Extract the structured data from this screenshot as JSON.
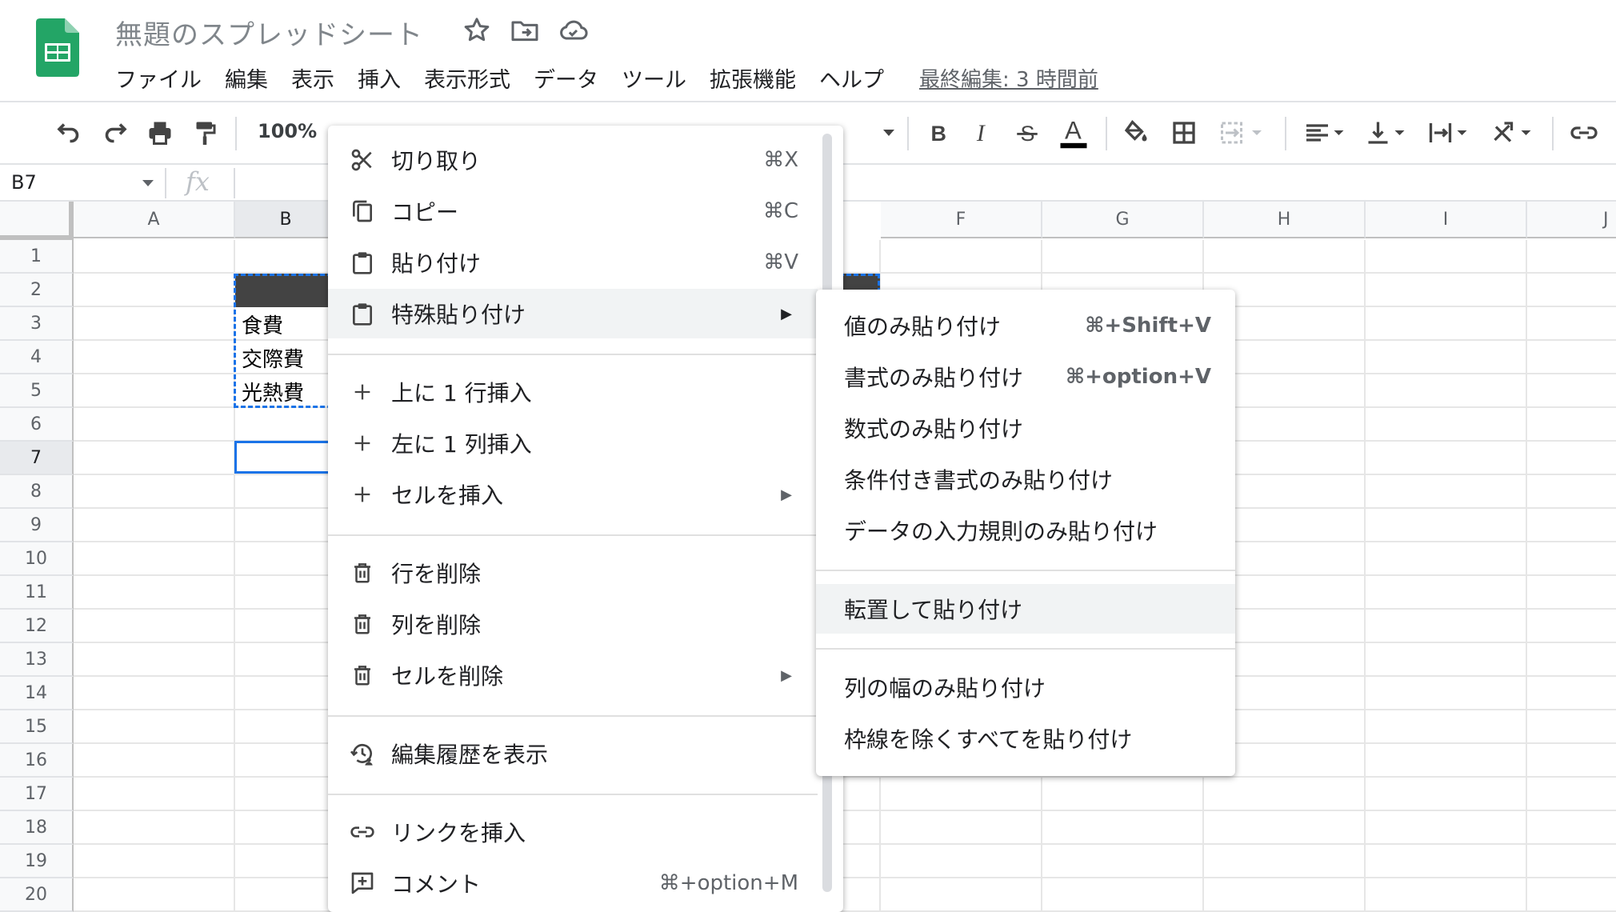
{
  "header": {
    "title": "無題のスプレッドシート",
    "menus": [
      "ファイル",
      "編集",
      "表示",
      "挿入",
      "表示形式",
      "データ",
      "ツール",
      "拡張機能",
      "ヘルプ"
    ],
    "last_edit": "最終編集: 3 時間前"
  },
  "toolbar": {
    "zoom": "100%"
  },
  "formula_bar": {
    "name_box": "B7",
    "fx_label": "fx"
  },
  "grid": {
    "columns": [
      "A",
      "B",
      "F",
      "G",
      "H",
      "I",
      "J"
    ],
    "rows": [
      "1",
      "2",
      "3",
      "4",
      "5",
      "6",
      "7",
      "8",
      "9",
      "10",
      "11",
      "12",
      "13",
      "14",
      "15",
      "16",
      "17",
      "18",
      "19",
      "20"
    ],
    "cells": {
      "b3": "食費",
      "b4": "交際費",
      "b5": "光熱費"
    }
  },
  "context_menu": {
    "items": [
      {
        "label": "切り取り",
        "shortcut": "⌘X",
        "icon": "scissors-icon"
      },
      {
        "label": "コピー",
        "shortcut": "⌘C",
        "icon": "copy-icon"
      },
      {
        "label": "貼り付け",
        "shortcut": "⌘V",
        "icon": "clipboard-icon"
      },
      {
        "label": "特殊貼り付け",
        "icon": "clipboard-icon"
      },
      {
        "label": "上に 1 行挿入",
        "icon": "plus-icon"
      },
      {
        "label": "左に 1 列挿入",
        "icon": "plus-icon"
      },
      {
        "label": "セルを挿入",
        "icon": "plus-icon"
      },
      {
        "label": "行を削除",
        "icon": "trash-icon"
      },
      {
        "label": "列を削除",
        "icon": "trash-icon"
      },
      {
        "label": "セルを削除",
        "icon": "trash-icon"
      },
      {
        "label": "編集履歴を表示",
        "icon": "history-icon"
      },
      {
        "label": "リンクを挿入",
        "icon": "link-icon"
      },
      {
        "label": "コメント",
        "shortcut": "⌘+option+M",
        "icon": "add-comment-icon"
      }
    ]
  },
  "paste_special_menu": {
    "items": [
      {
        "label": "値のみ貼り付け",
        "shortcut": "⌘+Shift+V"
      },
      {
        "label": "書式のみ貼り付け",
        "shortcut": "⌘+option+V"
      },
      {
        "label": "数式のみ貼り付け"
      },
      {
        "label": "条件付き書式のみ貼り付け"
      },
      {
        "label": "データの入力規則のみ貼り付け"
      },
      {
        "label": "転置して貼り付け"
      },
      {
        "label": "列の幅のみ貼り付け"
      },
      {
        "label": "枠線を除くすべてを貼り付け"
      }
    ]
  },
  "colors": {
    "sheets_green": "#188038",
    "selection_blue": "#1a73e8",
    "header_fill": "#434343",
    "hover_gray": "#f1f3f4"
  }
}
